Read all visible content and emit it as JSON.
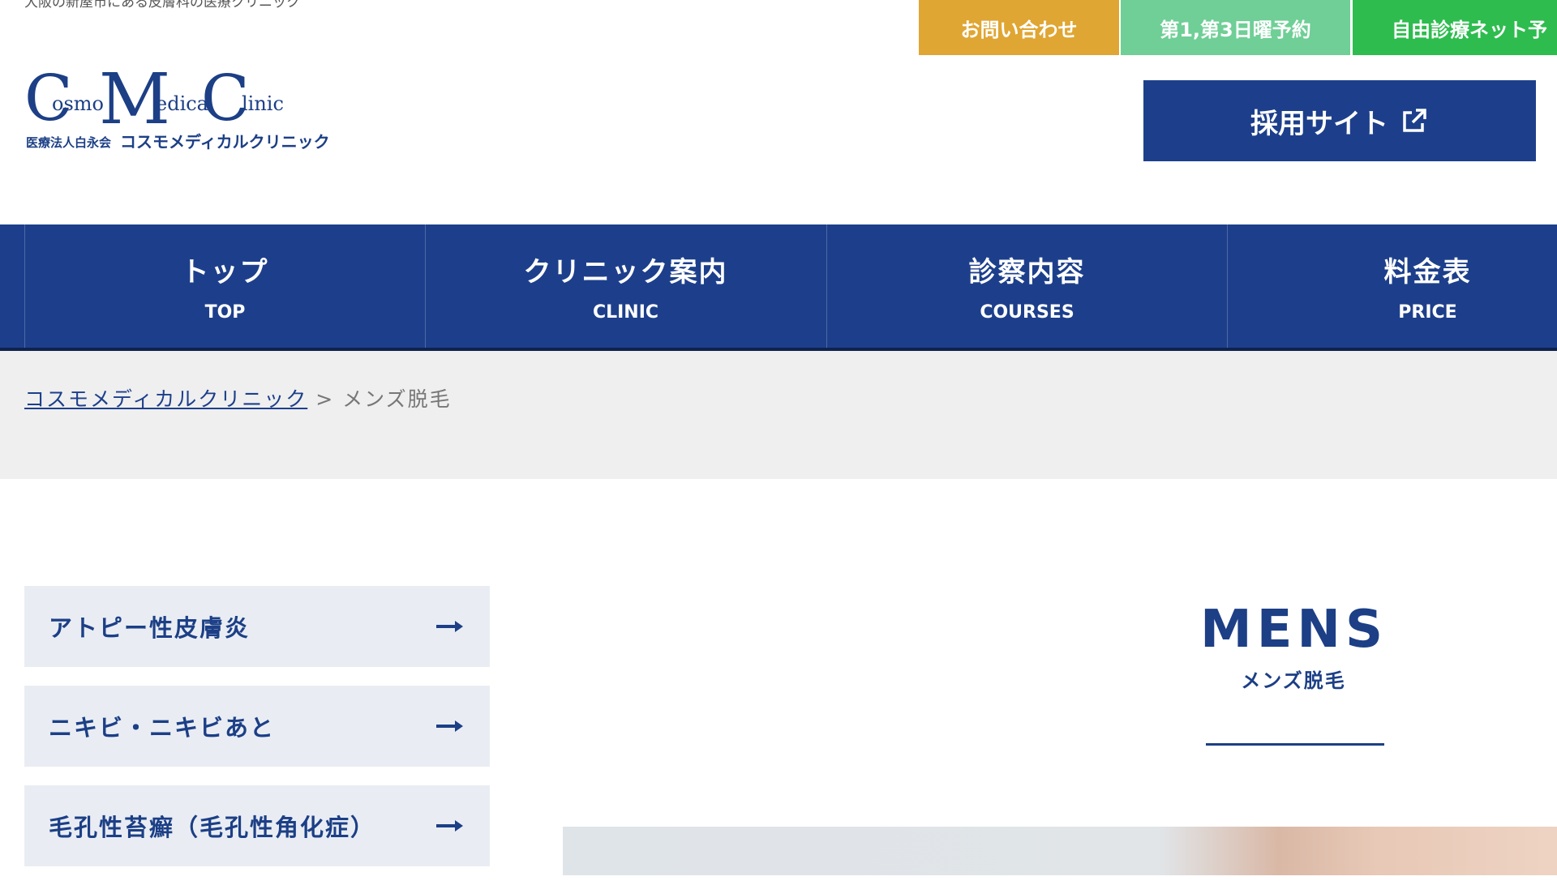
{
  "header": {
    "tagline": "大阪の新屋市にある皮膚科の医療クリニック",
    "logo": {
      "wordmark": "CosmoMedicalClinic",
      "subtext": "医療法人白永会 コスモメディカルクリニック"
    },
    "top_buttons": [
      {
        "label": "お問い合わせ",
        "color": "#e0a633"
      },
      {
        "label": "第1,第3日曜予約",
        "color": "#6fcf96"
      },
      {
        "label": "自由診療ネット予",
        "color": "#2ebc4f"
      }
    ],
    "recruit": {
      "label": "採用サイト",
      "icon": "external-link-icon"
    }
  },
  "nav": [
    {
      "jp": "トップ",
      "en": "TOP"
    },
    {
      "jp": "クリニック案内",
      "en": "CLINIC"
    },
    {
      "jp": "診察内容",
      "en": "COURSES"
    },
    {
      "jp": "料金表",
      "en": "PRICE"
    }
  ],
  "breadcrumb": {
    "home": "コスモメディカルクリニック",
    "separator": " > ",
    "current": "メンズ脱毛"
  },
  "sidebar": {
    "items": [
      {
        "label": "アトピー性皮膚炎",
        "icon": "arrow-right-icon"
      },
      {
        "label": "ニキビ・ニキビあと",
        "icon": "arrow-right-icon"
      },
      {
        "label": "毛孔性苔癬（毛孔性角化症）",
        "icon": "arrow-right-icon"
      }
    ]
  },
  "main": {
    "title": "MENS",
    "subtitle": "メンズ脱毛"
  },
  "colors": {
    "navy": "#1d3f8b",
    "contact": "#e0a633",
    "reserve": "#6fcf96",
    "net": "#2ebc4f",
    "crumb_bg": "#efefef"
  }
}
